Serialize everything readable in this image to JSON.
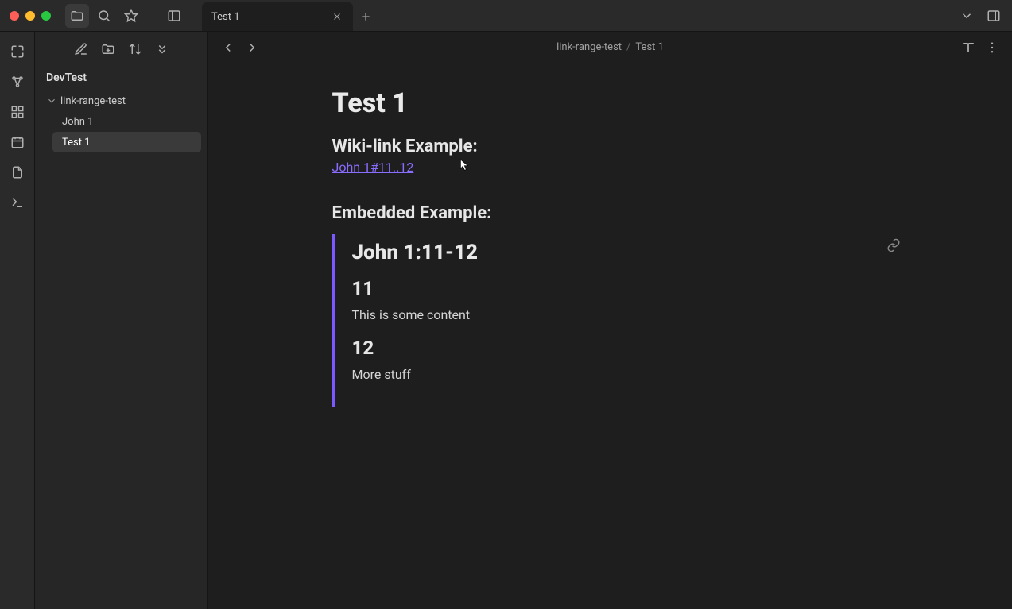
{
  "tabs": [
    {
      "label": "Test 1"
    }
  ],
  "titlebar_tools": {
    "folder": "folder-icon",
    "search": "search-icon",
    "star": "star-icon",
    "sidebar_left": "sidebar-left-icon",
    "chevron_down": "chevron-down-icon",
    "panels": "panels-icon"
  },
  "sidebar": {
    "vault": "DevTest",
    "tree": {
      "folder": "link-range-test",
      "files": [
        {
          "label": "John 1"
        },
        {
          "label": "Test 1",
          "selected": true
        }
      ]
    }
  },
  "breadcrumb": {
    "segments": [
      "link-range-test",
      "Test 1"
    ],
    "sep": "/"
  },
  "document": {
    "title": "Test 1",
    "wikilink_heading": "Wiki-link Example:",
    "wikilink_text": "John 1#11..12",
    "embedded_heading": "Embedded Example:",
    "embed": {
      "title": "John 1:11-12",
      "sections": [
        {
          "heading": "11",
          "body": "This is some content"
        },
        {
          "heading": "12",
          "body": "More stuff"
        }
      ]
    }
  }
}
